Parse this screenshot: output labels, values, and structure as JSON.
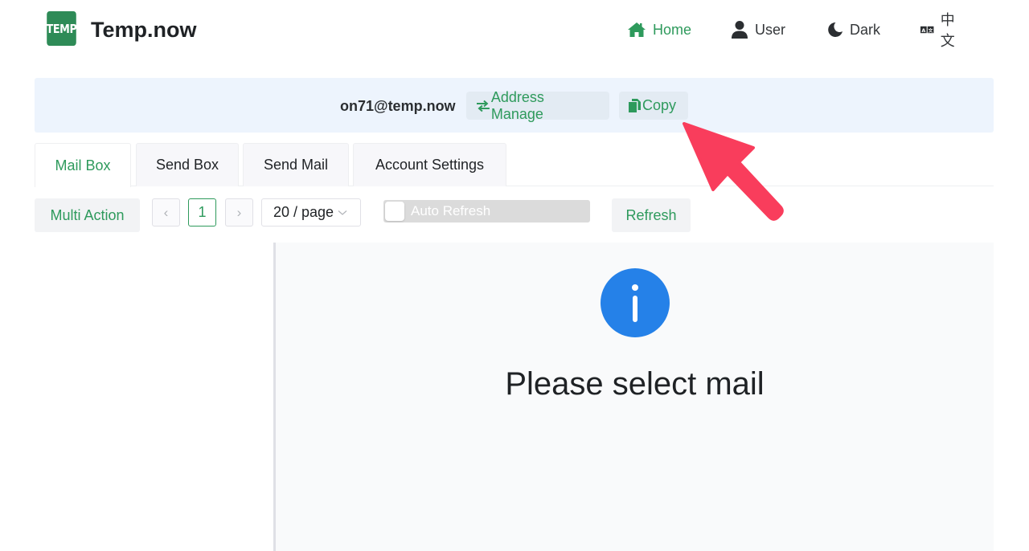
{
  "header": {
    "logo_text": "TEMP",
    "brand": "Temp.now",
    "nav": [
      {
        "label": "Home",
        "icon": "home-icon",
        "active": true
      },
      {
        "label": "User",
        "icon": "user-icon",
        "active": false
      },
      {
        "label": "Dark",
        "icon": "moon-icon",
        "active": false
      },
      {
        "label": "中文",
        "icon": "translate-icon",
        "active": false
      }
    ]
  },
  "address": {
    "email": "on71@temp.now",
    "manage_label": "Address Manage",
    "copy_label": "Copy"
  },
  "tabs": [
    {
      "label": "Mail Box",
      "active": true
    },
    {
      "label": "Send Box",
      "active": false
    },
    {
      "label": "Send Mail",
      "active": false
    },
    {
      "label": "Account Settings",
      "active": false
    }
  ],
  "toolbar": {
    "multi_action_label": "Multi Action",
    "pager": {
      "prev_glyph": "‹",
      "current_page": "1",
      "next_glyph": "›"
    },
    "page_size": "20 / page",
    "auto_refresh_label": "Auto Refresh",
    "auto_refresh_on": false,
    "refresh_label": "Refresh"
  },
  "detail": {
    "empty_message": "Please select mail"
  },
  "colors": {
    "accent": "#2e9a5c",
    "logo_bg": "#2e8b57",
    "address_bar_bg": "#edf4fd",
    "info_icon": "#2581e8",
    "annotation_arrow": "#f93d5c"
  }
}
